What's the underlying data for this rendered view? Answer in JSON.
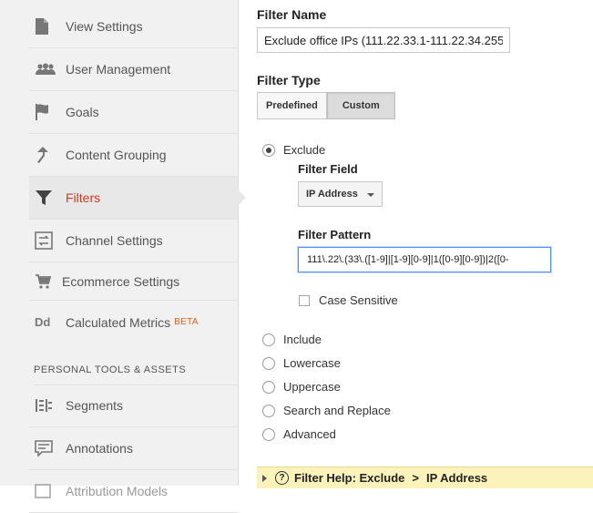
{
  "sidebar": {
    "items": [
      {
        "label": "View Settings",
        "icon": "document-icon"
      },
      {
        "label": "User Management",
        "icon": "users-icon"
      },
      {
        "label": "Goals",
        "icon": "flag-icon"
      },
      {
        "label": "Content Grouping",
        "icon": "grouping-icon"
      },
      {
        "label": "Filters",
        "icon": "funnel-icon",
        "active": true
      },
      {
        "label": "Channel Settings",
        "icon": "channel-icon"
      },
      {
        "label": "Ecommerce Settings",
        "icon": "cart-icon"
      },
      {
        "label": "Calculated Metrics",
        "icon": "dd-icon",
        "badge": "BETA"
      }
    ],
    "section_title": "PERSONAL TOOLS & ASSETS",
    "items2": [
      {
        "label": "Segments",
        "icon": "segments-icon"
      },
      {
        "label": "Annotations",
        "icon": "annotations-icon"
      },
      {
        "label": "Attribution Models",
        "icon": "attribution-icon"
      }
    ]
  },
  "main": {
    "filter_name_label": "Filter Name",
    "filter_name_value": "Exclude office IPs (111.22.33.1-111.22.34.255",
    "filter_type_label": "Filter Type",
    "type_buttons": [
      "Predefined",
      "Custom"
    ],
    "selected_type": "Custom",
    "options": {
      "exclude": "Exclude",
      "include": "Include",
      "lowercase": "Lowercase",
      "uppercase": "Uppercase",
      "search_replace": "Search and Replace",
      "advanced": "Advanced"
    },
    "filter_field_label": "Filter Field",
    "filter_field_value": "IP Address",
    "filter_pattern_label": "Filter Pattern",
    "filter_pattern_value": "111\\.22\\.(33\\.([1-9]|[1-9][0-9]|1([0-9][0-9])|2([0-",
    "case_sensitive_label": "Case Sensitive"
  },
  "help": {
    "prefix": "Filter Help: Exclude",
    "separator": ">",
    "suffix": "IP Address"
  },
  "colors": {
    "active_text": "#cf3b22",
    "beta": "#e55c1f",
    "help_bg": "#fcf3bb",
    "focus_border": "#4d90fe"
  }
}
